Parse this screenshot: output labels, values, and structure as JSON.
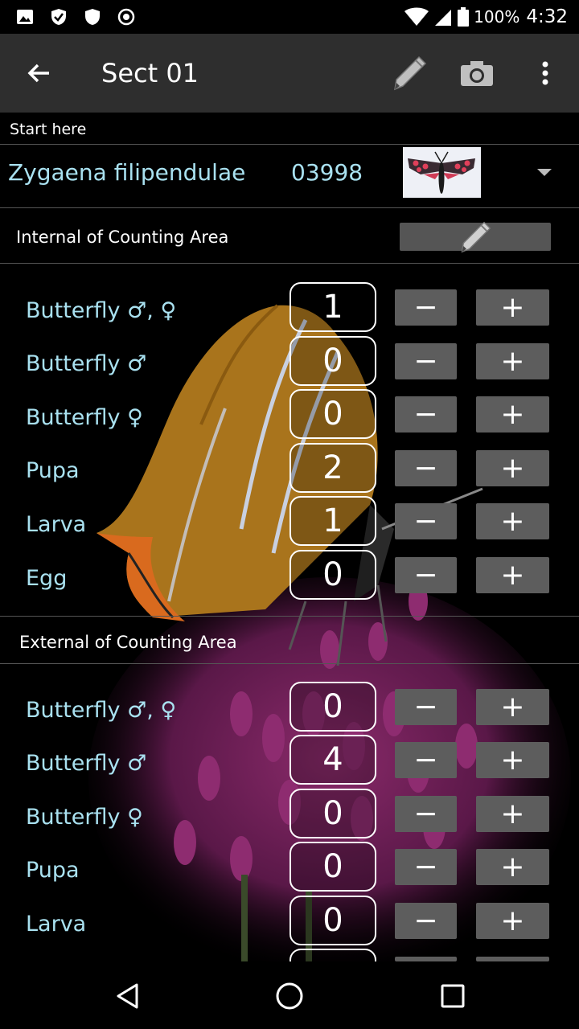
{
  "status_bar": {
    "battery_percent": "100%",
    "clock": "4:32"
  },
  "toolbar": {
    "title": "Sect 01",
    "icons": [
      "back-arrow-icon",
      "pencil-icon",
      "camera-icon",
      "overflow-menu-icon"
    ]
  },
  "start_here": "Start here",
  "species": {
    "name": "Zygaena filipendulae",
    "code": "03998"
  },
  "internal": {
    "title": "Internal of Counting Area",
    "rows": [
      {
        "label": "Butterfly ♂, ♀",
        "count": "1"
      },
      {
        "label": "Butterfly ♂",
        "count": "0"
      },
      {
        "label": "Butterfly ♀",
        "count": "0"
      },
      {
        "label": "Pupa",
        "count": "2"
      },
      {
        "label": "Larva",
        "count": "1"
      },
      {
        "label": "Egg",
        "count": "0"
      }
    ]
  },
  "external": {
    "title": "External of Counting Area",
    "rows": [
      {
        "label": "Butterfly ♂, ♀",
        "count": "0"
      },
      {
        "label": "Butterfly ♂",
        "count": "4"
      },
      {
        "label": "Butterfly ♀",
        "count": "0"
      },
      {
        "label": "Pupa",
        "count": "0"
      },
      {
        "label": "Larva",
        "count": "0"
      }
    ]
  },
  "buttons": {
    "minus": "−",
    "plus": "+"
  },
  "colors": {
    "label_color": "#a9e1f0",
    "toolbar_bg": "#2e2e2e",
    "button_bg": "#5d5d5d"
  }
}
